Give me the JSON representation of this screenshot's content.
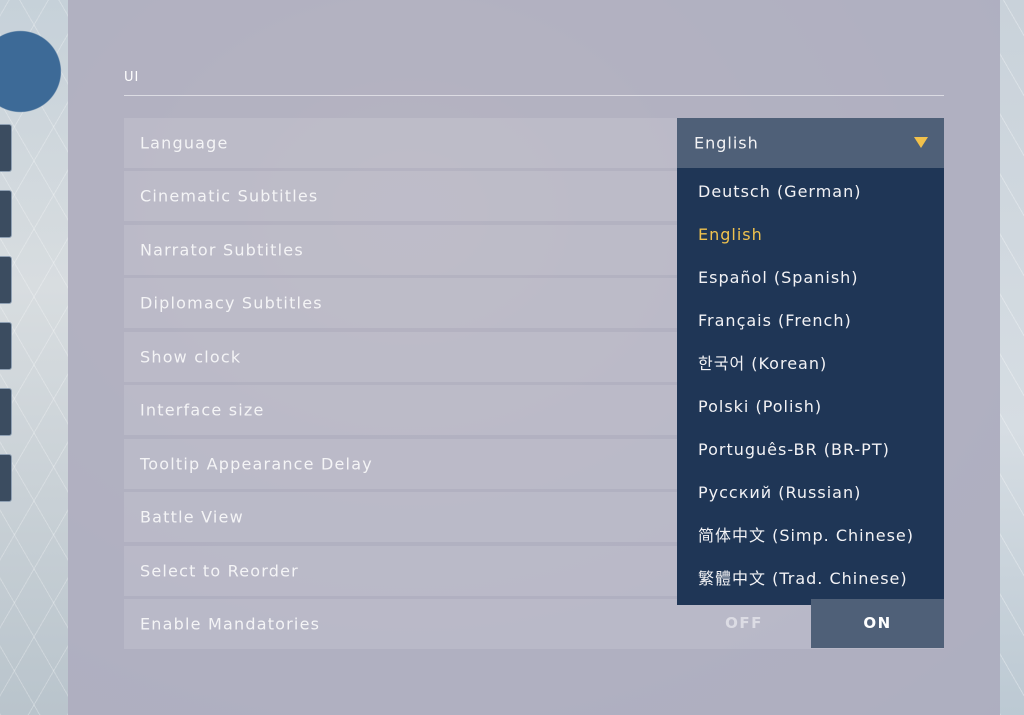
{
  "section": {
    "title": "UI"
  },
  "settings": [
    {
      "label": "Language"
    },
    {
      "label": "Cinematic Subtitles"
    },
    {
      "label": "Narrator Subtitles"
    },
    {
      "label": "Diplomacy Subtitles"
    },
    {
      "label": "Show clock"
    },
    {
      "label": "Interface size"
    },
    {
      "label": "Tooltip Appearance Delay"
    },
    {
      "label": "Battle View"
    },
    {
      "label": "Select to Reorder"
    },
    {
      "label": "Enable Mandatories"
    }
  ],
  "language_select": {
    "value": "English",
    "icon": "chevron-down-icon",
    "accent_color": "#f2c14b",
    "options": [
      "Deutsch (German)",
      "English",
      "Español (Spanish)",
      "Français (French)",
      "한국어 (Korean)",
      "Polski (Polish)",
      "Português-BR (BR-PT)",
      "Русский (Russian)",
      "简体中文 (Simp. Chinese)",
      "繁體中文 (Trad. Chinese)"
    ],
    "selected_option": "English"
  },
  "mandatories_toggle": {
    "off_label": "OFF",
    "on_label": "ON",
    "value": "ON"
  }
}
